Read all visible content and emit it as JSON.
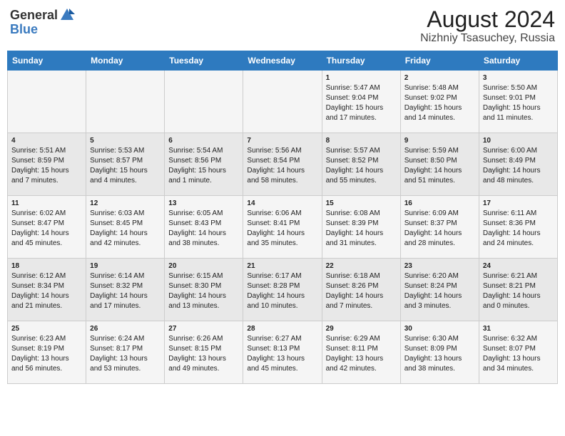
{
  "header": {
    "logo_general": "General",
    "logo_blue": "Blue",
    "title": "August 2024",
    "subtitle": "Nizhniy Tsasuchey, Russia"
  },
  "days_of_week": [
    "Sunday",
    "Monday",
    "Tuesday",
    "Wednesday",
    "Thursday",
    "Friday",
    "Saturday"
  ],
  "weeks": [
    [
      {
        "day": "",
        "content": ""
      },
      {
        "day": "",
        "content": ""
      },
      {
        "day": "",
        "content": ""
      },
      {
        "day": "",
        "content": ""
      },
      {
        "day": "1",
        "content": "Sunrise: 5:47 AM\nSunset: 9:04 PM\nDaylight: 15 hours and 17 minutes."
      },
      {
        "day": "2",
        "content": "Sunrise: 5:48 AM\nSunset: 9:02 PM\nDaylight: 15 hours and 14 minutes."
      },
      {
        "day": "3",
        "content": "Sunrise: 5:50 AM\nSunset: 9:01 PM\nDaylight: 15 hours and 11 minutes."
      }
    ],
    [
      {
        "day": "4",
        "content": "Sunrise: 5:51 AM\nSunset: 8:59 PM\nDaylight: 15 hours and 7 minutes."
      },
      {
        "day": "5",
        "content": "Sunrise: 5:53 AM\nSunset: 8:57 PM\nDaylight: 15 hours and 4 minutes."
      },
      {
        "day": "6",
        "content": "Sunrise: 5:54 AM\nSunset: 8:56 PM\nDaylight: 15 hours and 1 minute."
      },
      {
        "day": "7",
        "content": "Sunrise: 5:56 AM\nSunset: 8:54 PM\nDaylight: 14 hours and 58 minutes."
      },
      {
        "day": "8",
        "content": "Sunrise: 5:57 AM\nSunset: 8:52 PM\nDaylight: 14 hours and 55 minutes."
      },
      {
        "day": "9",
        "content": "Sunrise: 5:59 AM\nSunset: 8:50 PM\nDaylight: 14 hours and 51 minutes."
      },
      {
        "day": "10",
        "content": "Sunrise: 6:00 AM\nSunset: 8:49 PM\nDaylight: 14 hours and 48 minutes."
      }
    ],
    [
      {
        "day": "11",
        "content": "Sunrise: 6:02 AM\nSunset: 8:47 PM\nDaylight: 14 hours and 45 minutes."
      },
      {
        "day": "12",
        "content": "Sunrise: 6:03 AM\nSunset: 8:45 PM\nDaylight: 14 hours and 42 minutes."
      },
      {
        "day": "13",
        "content": "Sunrise: 6:05 AM\nSunset: 8:43 PM\nDaylight: 14 hours and 38 minutes."
      },
      {
        "day": "14",
        "content": "Sunrise: 6:06 AM\nSunset: 8:41 PM\nDaylight: 14 hours and 35 minutes."
      },
      {
        "day": "15",
        "content": "Sunrise: 6:08 AM\nSunset: 8:39 PM\nDaylight: 14 hours and 31 minutes."
      },
      {
        "day": "16",
        "content": "Sunrise: 6:09 AM\nSunset: 8:37 PM\nDaylight: 14 hours and 28 minutes."
      },
      {
        "day": "17",
        "content": "Sunrise: 6:11 AM\nSunset: 8:36 PM\nDaylight: 14 hours and 24 minutes."
      }
    ],
    [
      {
        "day": "18",
        "content": "Sunrise: 6:12 AM\nSunset: 8:34 PM\nDaylight: 14 hours and 21 minutes."
      },
      {
        "day": "19",
        "content": "Sunrise: 6:14 AM\nSunset: 8:32 PM\nDaylight: 14 hours and 17 minutes."
      },
      {
        "day": "20",
        "content": "Sunrise: 6:15 AM\nSunset: 8:30 PM\nDaylight: 14 hours and 13 minutes."
      },
      {
        "day": "21",
        "content": "Sunrise: 6:17 AM\nSunset: 8:28 PM\nDaylight: 14 hours and 10 minutes."
      },
      {
        "day": "22",
        "content": "Sunrise: 6:18 AM\nSunset: 8:26 PM\nDaylight: 14 hours and 7 minutes."
      },
      {
        "day": "23",
        "content": "Sunrise: 6:20 AM\nSunset: 8:24 PM\nDaylight: 14 hours and 3 minutes."
      },
      {
        "day": "24",
        "content": "Sunrise: 6:21 AM\nSunset: 8:21 PM\nDaylight: 14 hours and 0 minutes."
      }
    ],
    [
      {
        "day": "25",
        "content": "Sunrise: 6:23 AM\nSunset: 8:19 PM\nDaylight: 13 hours and 56 minutes."
      },
      {
        "day": "26",
        "content": "Sunrise: 6:24 AM\nSunset: 8:17 PM\nDaylight: 13 hours and 53 minutes."
      },
      {
        "day": "27",
        "content": "Sunrise: 6:26 AM\nSunset: 8:15 PM\nDaylight: 13 hours and 49 minutes."
      },
      {
        "day": "28",
        "content": "Sunrise: 6:27 AM\nSunset: 8:13 PM\nDaylight: 13 hours and 45 minutes."
      },
      {
        "day": "29",
        "content": "Sunrise: 6:29 AM\nSunset: 8:11 PM\nDaylight: 13 hours and 42 minutes."
      },
      {
        "day": "30",
        "content": "Sunrise: 6:30 AM\nSunset: 8:09 PM\nDaylight: 13 hours and 38 minutes."
      },
      {
        "day": "31",
        "content": "Sunrise: 6:32 AM\nSunset: 8:07 PM\nDaylight: 13 hours and 34 minutes."
      }
    ]
  ]
}
